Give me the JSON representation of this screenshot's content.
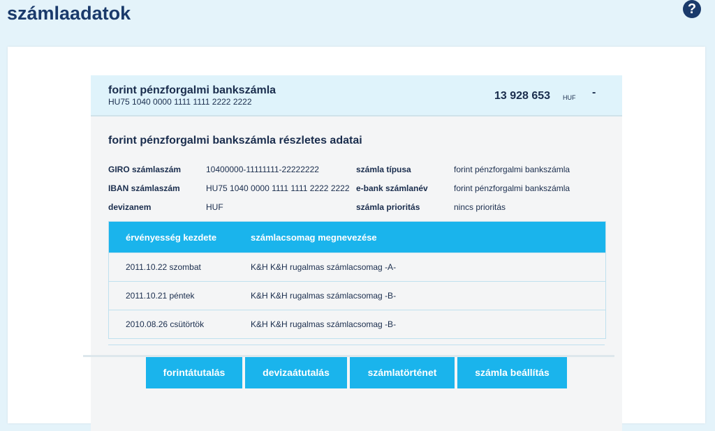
{
  "header": {
    "title": "számlaadatok",
    "help_icon": "question-circle-icon",
    "help_label": "?"
  },
  "account": {
    "name": "forint pénzforgalmi bankszámla",
    "iban": "HU75 1040 0000 1111 1111 2222 2222",
    "balance": "13 928 653",
    "currency": "HUF",
    "dash": "-"
  },
  "details": {
    "title": "forint pénzforgalmi bankszámla részletes adatai",
    "rows": [
      {
        "label": "GIRO számlaszám",
        "value": "10400000-11111111-22222222",
        "label2": "számla típusa",
        "value2": "forint pénzforgalmi bankszámla"
      },
      {
        "label": "IBAN számlaszám",
        "value": "HU75 1040 0000 1111 1111 2222 2222",
        "label2": "e-bank számlanév",
        "value2": "forint pénzforgalmi bankszámla"
      },
      {
        "label": "devizanem",
        "value": "HUF",
        "label2": "számla prioritás",
        "value2": "nincs prioritás"
      }
    ]
  },
  "table": {
    "headers": [
      "érvényesség kezdete",
      "számlacsomag megnevezése"
    ],
    "rows": [
      [
        "2011.10.22 szombat",
        "K&H K&H rugalmas számlacsomag -A-"
      ],
      [
        "2011.10.21 péntek",
        "K&H K&H rugalmas számlacsomag -B-"
      ],
      [
        "2010.08.26 csütörtök",
        "K&H K&H rugalmas számlacsomag -B-"
      ]
    ]
  },
  "buttons": {
    "forint_transfer": "forintátutalás",
    "fx_transfer": "devizaátutalás",
    "history": "számlatörténet",
    "settings": "számla beállítás"
  },
  "colors": {
    "accent": "#1ab4ec",
    "header_bg": "#dff3fb",
    "page_bg": "#e4f3fa",
    "text": "#1a2d4d"
  }
}
